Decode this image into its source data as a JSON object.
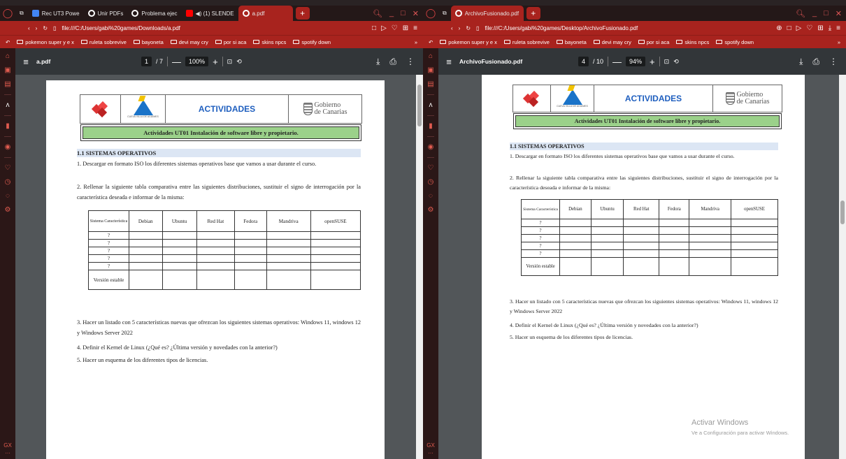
{
  "left_window": {
    "tabs": [
      {
        "label": "",
        "icon": "split-icon"
      },
      {
        "label": "Rec UT3 Powe",
        "icon": "docs-icon",
        "color": "#4285f4"
      },
      {
        "label": "Unir PDFs",
        "icon": "globe-icon",
        "color": "#ffffff"
      },
      {
        "label": "Problema ejec",
        "icon": "globe-icon",
        "color": "#ffffff"
      },
      {
        "label": "◀) (1) SLENDE",
        "icon": "youtube-icon",
        "color": "#ff0000"
      },
      {
        "label": "a.pdf",
        "icon": "globe-icon",
        "color": "#ffffff"
      }
    ],
    "url": "file:///C:/Users/gabi%20games/Downloads/a.pdf",
    "pdf": {
      "title": "a.pdf",
      "page_current": "1",
      "page_total": "/ 7",
      "zoom": "100%"
    }
  },
  "right_window": {
    "tabs": [
      {
        "label": "",
        "icon": "split-icon"
      },
      {
        "label": "ArchivoFusionado.pdf",
        "icon": "globe-icon",
        "color": "#ffffff"
      }
    ],
    "url": "file:///C:/Users/gabi%20games/Desktop/ArchivoFusionado.pdf",
    "pdf": {
      "title": "ArchivoFusionado.pdf",
      "page_current": "4",
      "page_total": "/ 10",
      "zoom": "94%"
    }
  },
  "bookmarks": [
    "pokemon super y e x",
    "ruleta sobrevive",
    "bayoneta",
    "devi may cry",
    "por si aca",
    "skins npcs",
    "spotify down"
  ],
  "sidebar_badge": "GX",
  "document": {
    "header_title": "ACTIVIDADES",
    "logo_caption": "CUEVA VILLA DE AGÜIMES",
    "gov_line1": "Gobierno",
    "gov_line2": "de Canarias",
    "band": "Actividades UT01 Instalación de software libre y propietario.",
    "section": "1.1 SISTEMAS OPERATIVOS",
    "item1": "1.  Descargar en formato ISO los diferentes sistemas operativos base que vamos a usar durante el curso.",
    "item2": "2.  Rellenar la siguiente tabla comparativa entre las siguientes distribuciones, sustituir el signo de interrogación por la característica deseada e informar de la misma:",
    "table": {
      "corner": "Sistema Característica",
      "columns": [
        "Debian",
        "Ubuntu",
        "Red Hat",
        "Fedora",
        "Mandriva",
        "openSUSE"
      ],
      "rows": [
        "?",
        "?",
        "?",
        "?",
        "?",
        "Versión estable"
      ]
    },
    "item3": "3.  Hacer un listado con 5 características nuevas que ofrezcan los siguientes sistemas operativos: Windows 11, windows 12 y Windows Server 2022",
    "item4": "4.  Definir el Kernel de Linux (¿Qué es? ¿Última versión y novedades con la anterior?)",
    "item5": "5.  Hacer un esquema de los diferentes tipos de licencias."
  },
  "watermark": {
    "line1": "Activar Windows",
    "line2": "Ve a Configuración para activar Windows."
  }
}
